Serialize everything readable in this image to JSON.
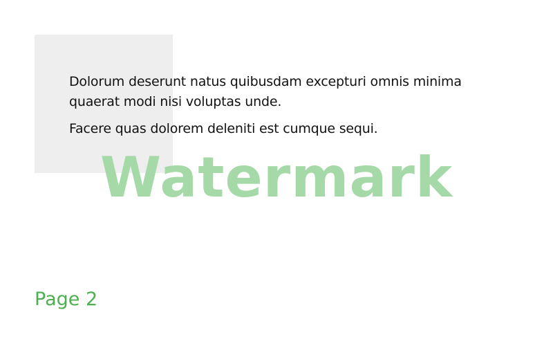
{
  "document": {
    "paragraphs": [
      "Dolorum deserunt natus quibusdam excepturi omnis minima quaerat modi nisi voluptas unde.",
      "Facere quas dolorem deleniti est cumque sequi."
    ],
    "watermark": "Watermark",
    "page_label": "Page 2"
  },
  "colors": {
    "background": "#ffffff",
    "shade_box": "#eeeeee",
    "text": "#111111",
    "watermark": "#a6d9a8",
    "page_label": "#4caf50"
  }
}
